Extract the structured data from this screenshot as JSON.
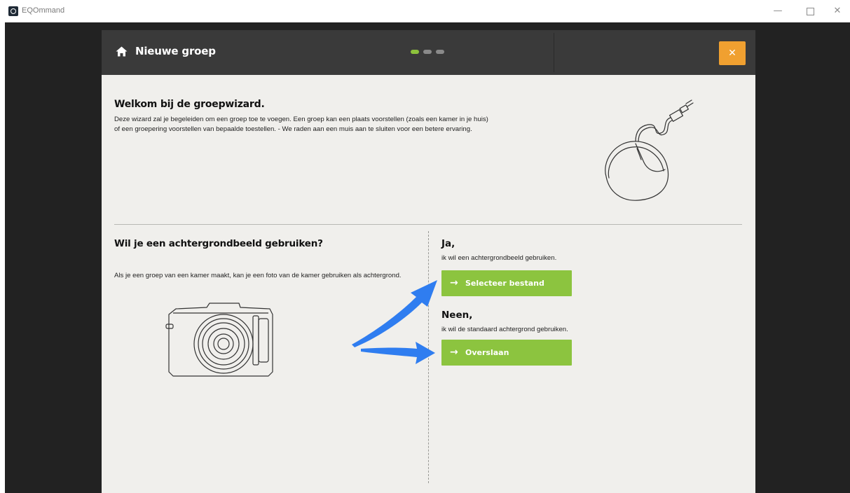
{
  "window": {
    "app_title": "EQOmmand",
    "minimize_glyph": "—",
    "maximize_glyph": "",
    "close_glyph": "✕"
  },
  "dialog": {
    "title": "Nieuwe groep",
    "close_glyph": "✕",
    "step_count": 3,
    "current_step": 1,
    "accent_color": "#8cc43f",
    "close_button_color": "#f0a030"
  },
  "welcome": {
    "title": "Welkom bij de groepwizard.",
    "lines": [
      "Deze wizard zal je begeleiden om een groep toe te voegen. Een groep kan een plaats voorstellen (zoals een kamer in je huis)",
      "of een groepering voorstellen van bepaalde toestellen. - We raden aan een muis aan te sluiten voor een betere ervaring."
    ]
  },
  "background_question": {
    "title": "Wil je een achtergrondbeeld gebruiken?",
    "description": "Als je een groep van een kamer maakt, kan je een foto van de kamer gebruiken als achtergrond."
  },
  "option_yes": {
    "title": "Ja,",
    "subtitle": "ik wil een achtergrondbeeld gebruiken.",
    "button_label": "Selecteer bestand",
    "button_arrow": "→"
  },
  "option_no": {
    "title": "Neen,",
    "subtitle": "ik wil de standaard achtergrond gebruiken.",
    "button_label": "Overslaan",
    "button_arrow": "→"
  },
  "icons": {
    "header": "home-icon",
    "welcome_illustration": "mouse-icon",
    "background_illustration": "camera-icon",
    "annotation": "blue-arrow-icon"
  },
  "colors": {
    "app_background": "#222222",
    "header_background": "#3a3a3a",
    "body_background": "#f0efec",
    "annotation_arrow": "#2f7df0"
  }
}
